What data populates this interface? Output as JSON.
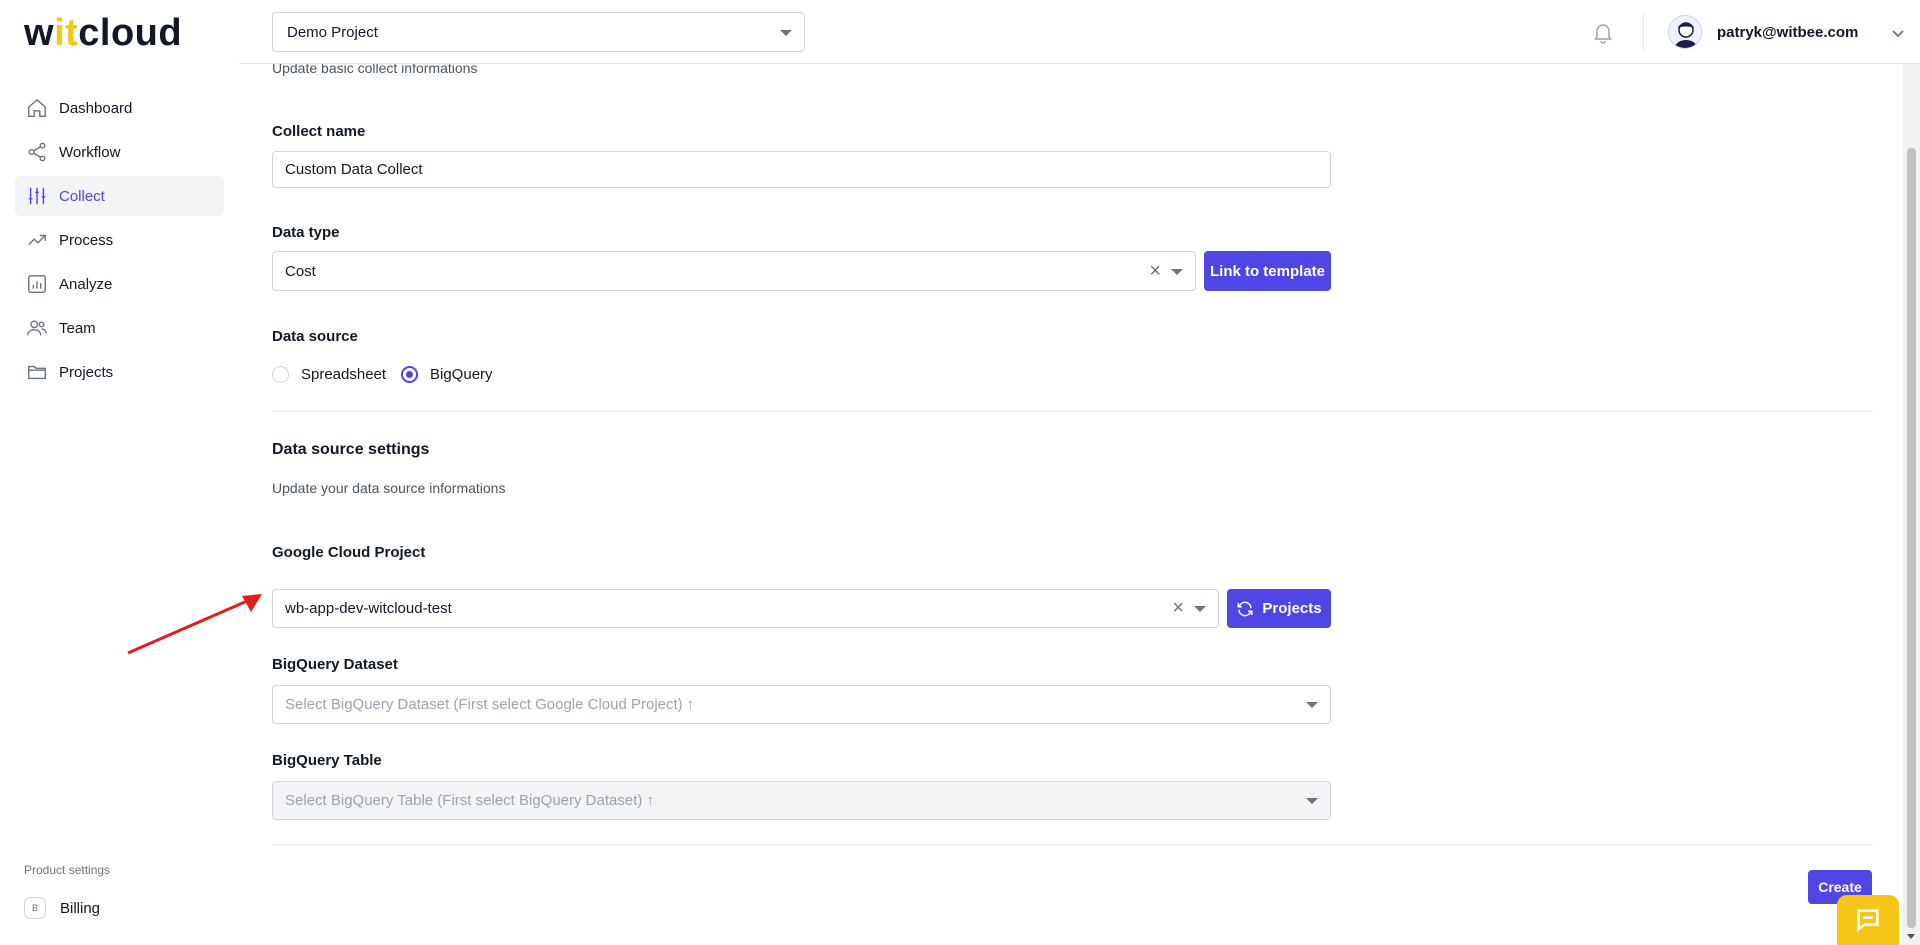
{
  "brand": {
    "logo_pre": "w",
    "logo_it": "it",
    "logo_post": "cloud"
  },
  "sidebar": {
    "items": [
      {
        "label": "Dashboard",
        "icon": "home-icon"
      },
      {
        "label": "Workflow",
        "icon": "share-icon"
      },
      {
        "label": "Collect",
        "icon": "sliders-icon",
        "active": true
      },
      {
        "label": "Process",
        "icon": "trending-up-icon"
      },
      {
        "label": "Analyze",
        "icon": "bar-chart-icon"
      },
      {
        "label": "Team",
        "icon": "users-icon"
      },
      {
        "label": "Projects",
        "icon": "folder-icon"
      }
    ],
    "bottom_label": "Product settings",
    "billing": {
      "badge": "B",
      "label": "Billing"
    }
  },
  "header": {
    "project_select": "Demo Project",
    "user_email": "patryk@witbee.com"
  },
  "form": {
    "subtitle": "Update basic collect informations",
    "collect_name_label": "Collect name",
    "collect_name_value": "Custom Data Collect",
    "data_type_label": "Data type",
    "data_type_value": "Cost",
    "link_template_button": "Link to template",
    "data_source_label": "Data source",
    "radio_spreadsheet": "Spreadsheet",
    "radio_bigquery": "BigQuery",
    "selected_source": "BigQuery",
    "ds_settings_title": "Data source settings",
    "ds_settings_subtitle": "Update your data source informations",
    "gcp_label": "Google Cloud Project",
    "gcp_value": "wb-app-dev-witcloud-test",
    "projects_button": "Projects",
    "dataset_label": "BigQuery Dataset",
    "dataset_placeholder": "Select BigQuery Dataset (First select Google Cloud Project) ↑",
    "table_label": "BigQuery Table",
    "table_placeholder": "Select BigQuery Table (First select BigQuery Dataset) ↑",
    "create_button": "Create"
  },
  "colors": {
    "accent": "#4f46e5",
    "brand_yellow": "#f5c518",
    "annotation_arrow": "#e11d1d"
  }
}
